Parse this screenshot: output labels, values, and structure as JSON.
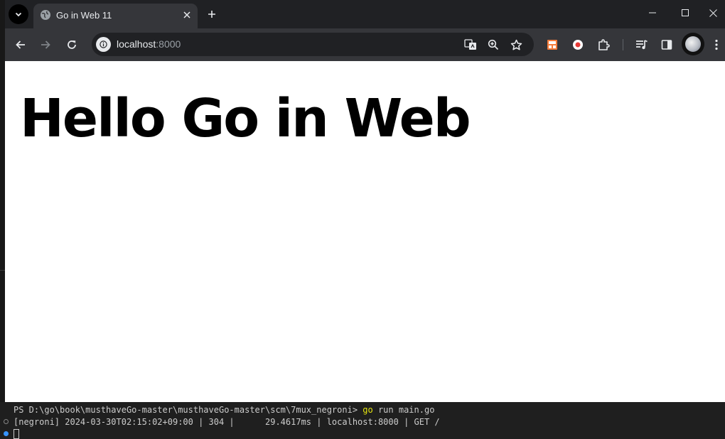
{
  "browser": {
    "tab": {
      "title": "Go in Web 11"
    },
    "address": {
      "host": "localhost",
      "port": ":8000"
    }
  },
  "page": {
    "heading": "Hello Go in Web"
  },
  "terminal": {
    "prompt": "PS D:\\go\\book\\musthaveGo-master\\musthaveGo-master\\scm\\7mux_negroni> ",
    "command_keyword": "go",
    "command_args": " run main.go",
    "log_line": "[negroni] 2024-03-30T02:15:02+09:00 | 304 |      29.4617ms | localhost:8000 | GET /"
  },
  "colors": {
    "go_keyword": "#e5e510",
    "terminal_bg": "#1f1f1f",
    "browser_frame": "#202124",
    "toolbar": "#35363a",
    "status_dot": "#3794ff"
  }
}
